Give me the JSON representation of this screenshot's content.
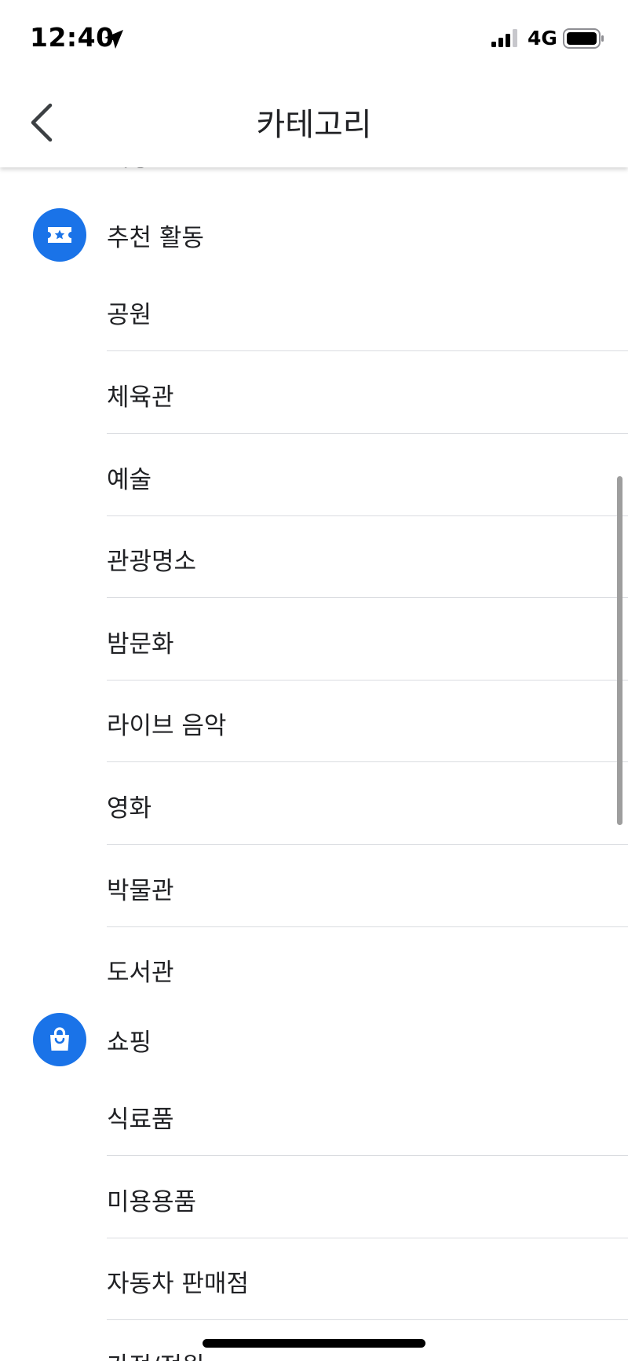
{
  "status_bar": {
    "time": "12:40",
    "network": "4G",
    "icons": [
      "location-arrow-icon",
      "signal-icon",
      "battery-icon"
    ]
  },
  "header": {
    "title": "카테고리",
    "back_icon": "chevron-left-icon"
  },
  "list": {
    "cut_off_top_label": "매장",
    "sections": [
      {
        "label": "추천 활동",
        "icon": "ticket-star-icon",
        "items": [
          "공원",
          "체육관",
          "예술",
          "관광명소",
          "밤문화",
          "라이브 음악",
          "영화",
          "박물관",
          "도서관"
        ]
      },
      {
        "label": "쇼핑",
        "icon": "shopping-bag-icon",
        "items": [
          "식료품",
          "미용용품",
          "자동차 판매점",
          "가전/전원"
        ]
      }
    ]
  },
  "colors": {
    "accent": "#1a73e8",
    "text": "#202124",
    "divider": "#dadce0"
  }
}
